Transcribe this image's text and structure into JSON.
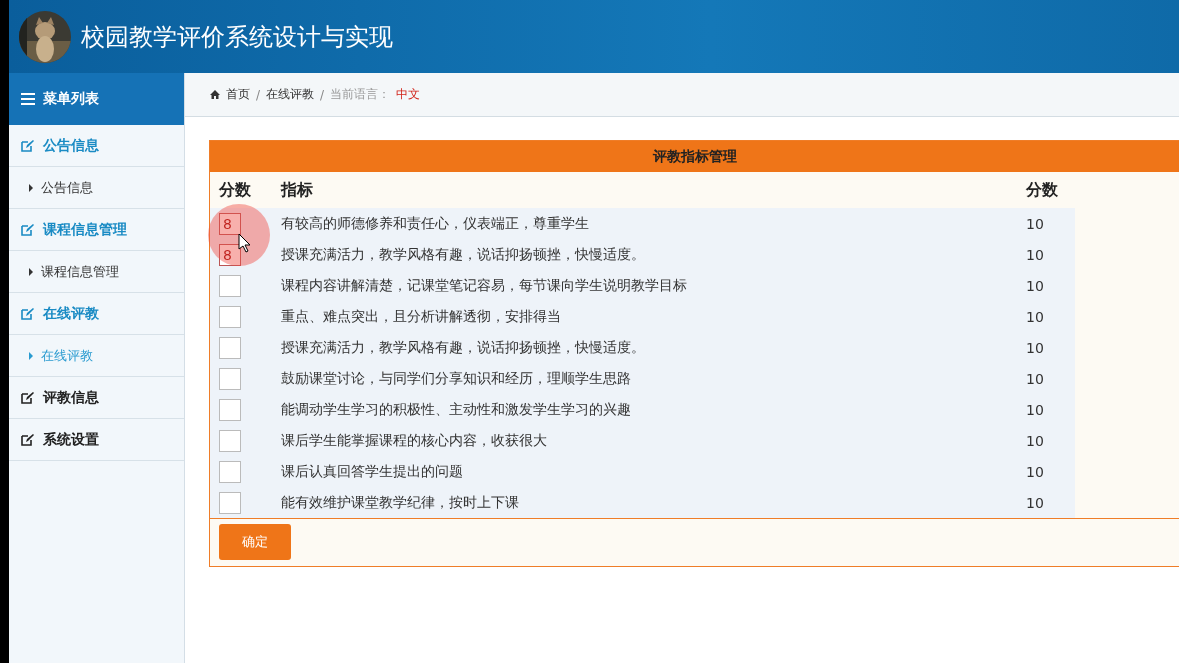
{
  "header": {
    "title": "校园教学评价系统设计与实现"
  },
  "sidebar": {
    "title": "菜单列表",
    "items": [
      {
        "kind": "group",
        "label": "公告信息",
        "expanded": true
      },
      {
        "kind": "sub",
        "label": "公告信息",
        "selected": false
      },
      {
        "kind": "group",
        "label": "课程信息管理",
        "expanded": true
      },
      {
        "kind": "sub",
        "label": "课程信息管理",
        "selected": false
      },
      {
        "kind": "group",
        "label": "在线评教",
        "expanded": true
      },
      {
        "kind": "sub",
        "label": "在线评教",
        "selected": true
      },
      {
        "kind": "group",
        "label": "评教信息",
        "expanded": false
      },
      {
        "kind": "group",
        "label": "系统设置",
        "expanded": false
      }
    ]
  },
  "breadcrumb": {
    "items": [
      "首页",
      "在线评教"
    ],
    "separator": "/",
    "language_label": "当前语言：",
    "language": "中文"
  },
  "panel": {
    "title": "评教指标管理",
    "columns": [
      "分数",
      "指标",
      "分数"
    ],
    "rows": [
      {
        "value": "8",
        "indicator": "有较高的师德修养和责任心，仪表端正，尊重学生",
        "max": "10"
      },
      {
        "value": "8",
        "indicator": "授课充满活力，教学风格有趣，说话抑扬顿挫，快慢适度。",
        "max": "10"
      },
      {
        "value": "",
        "indicator": "课程内容讲解清楚，记课堂笔记容易，每节课向学生说明教学目标",
        "max": "10"
      },
      {
        "value": "",
        "indicator": "重点、难点突出，且分析讲解透彻，安排得当",
        "max": "10"
      },
      {
        "value": "",
        "indicator": "授课充满活力，教学风格有趣，说话抑扬顿挫，快慢适度。",
        "max": "10"
      },
      {
        "value": "",
        "indicator": "鼓励课堂讨论，与同学们分享知识和经历，理顺学生思路",
        "max": "10"
      },
      {
        "value": "",
        "indicator": "能调动学生学习的积极性、主动性和激发学生学习的兴趣",
        "max": "10"
      },
      {
        "value": "",
        "indicator": "课后学生能掌握课程的核心内容，收获很大",
        "max": "10"
      },
      {
        "value": "",
        "indicator": "课后认真回答学生提出的问题",
        "max": "10"
      },
      {
        "value": "",
        "indicator": "能有效维护课堂教学纪律，按时上下课",
        "max": "10"
      }
    ],
    "submit": "确定"
  }
}
